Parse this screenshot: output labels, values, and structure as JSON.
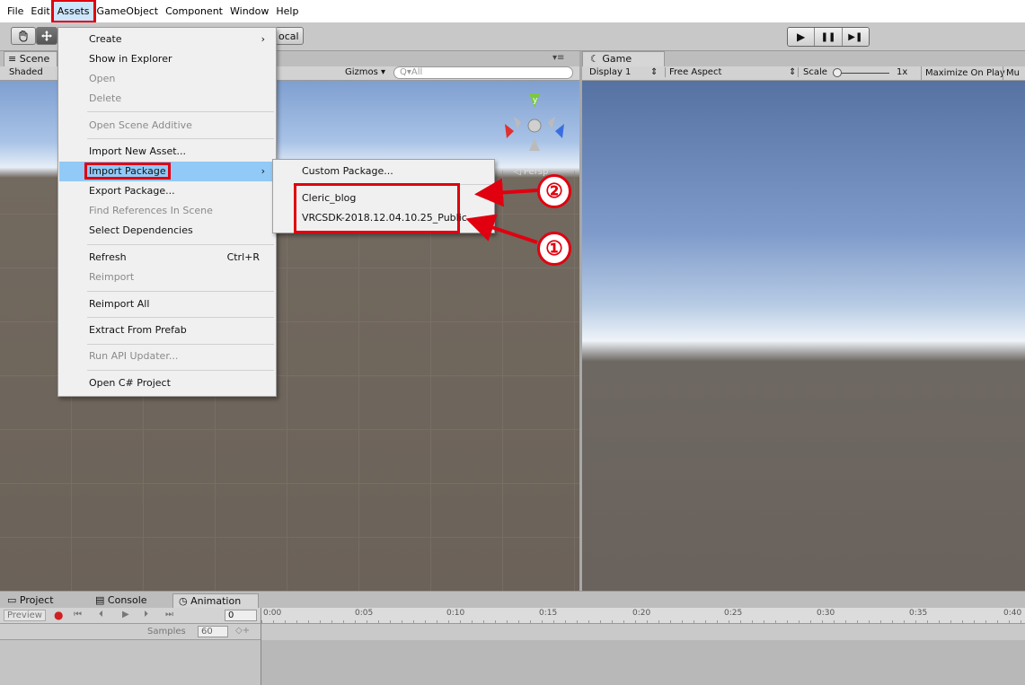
{
  "menubar": {
    "items": [
      "File",
      "Edit",
      "Assets",
      "GameObject",
      "Component",
      "Window",
      "Help"
    ]
  },
  "toolbar": {
    "hand_icon": "hand-icon",
    "move_icon": "move-icon",
    "local_label": "ocal",
    "play_icon": "▶",
    "pause_icon": "❚❚",
    "step_icon": "▶❚"
  },
  "scene": {
    "tab_label": "Scene",
    "shading_mode": "Shaded",
    "gizmos_label": "Gizmos",
    "search_placeholder": "Q▾All",
    "persp_label": "◁ Persp"
  },
  "game": {
    "tab_label": "Game",
    "display": "Display 1",
    "aspect": "Free Aspect",
    "scale_label": "Scale",
    "scale_value": "1x",
    "maximize_label": "Maximize On Play",
    "mute_label": "Mu"
  },
  "assets_menu": {
    "create": "Create",
    "show_in_explorer": "Show in Explorer",
    "open": "Open",
    "delete": "Delete",
    "open_scene_additive": "Open Scene Additive",
    "import_new_asset": "Import New Asset...",
    "import_package": "Import Package",
    "export_package": "Export Package...",
    "find_references": "Find References In Scene",
    "select_dependencies": "Select Dependencies",
    "refresh": "Refresh",
    "refresh_shortcut": "Ctrl+R",
    "reimport": "Reimport",
    "reimport_all": "Reimport All",
    "extract_from_prefab": "Extract From Prefab",
    "run_api_updater": "Run API Updater...",
    "open_csharp_project": "Open C# Project"
  },
  "import_submenu": {
    "custom_package": "Custom Package...",
    "cleric_blog": "Cleric_blog",
    "vrcsdk": "VRCSDK-2018.12.04.10.25_Public"
  },
  "annotations": {
    "one": "①",
    "two": "②"
  },
  "bottom": {
    "tabs": [
      "Project",
      "Console",
      "Animation"
    ],
    "preview_label": "Preview",
    "frame_value": "0",
    "samples_label": "Samples",
    "samples_value": "60",
    "timeline_ticks": [
      "0:00",
      "0:05",
      "0:10",
      "0:15",
      "0:20",
      "0:25",
      "0:30",
      "0:35",
      "0:40"
    ]
  },
  "colors": {
    "highlight_red": "#e0000f",
    "menu_highlight": "#91c9f7",
    "menu_bg": "#f0f0f0"
  }
}
